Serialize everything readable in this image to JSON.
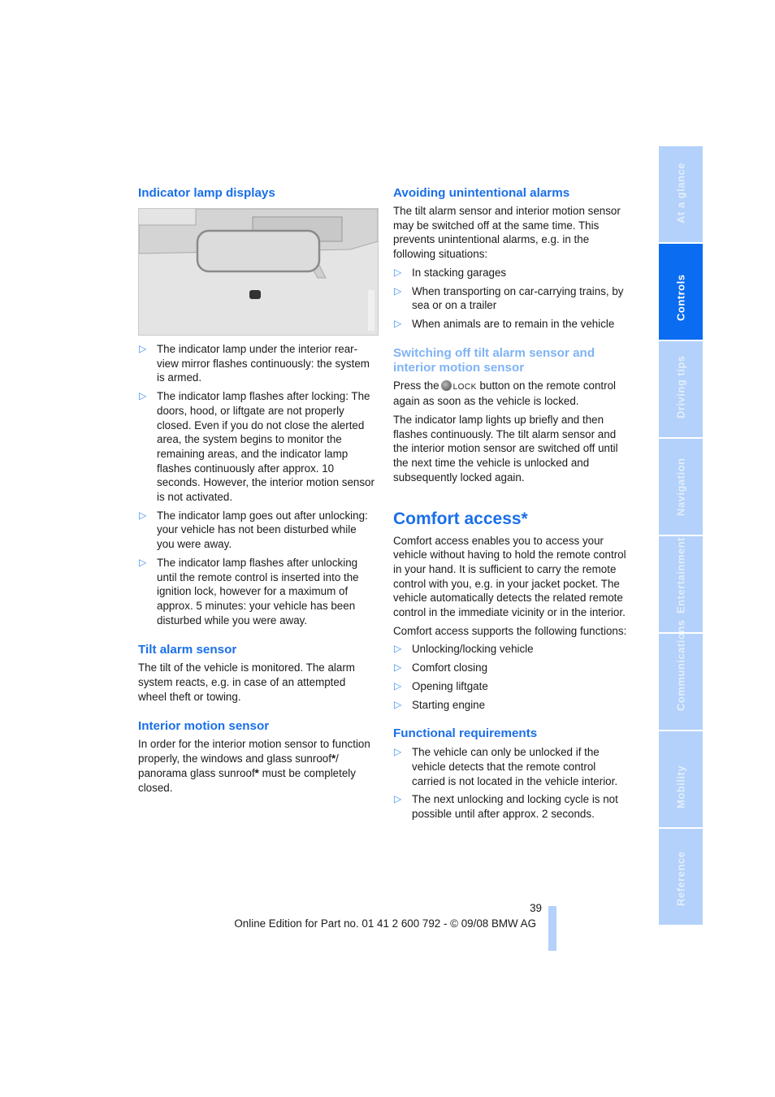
{
  "left_column": {
    "indicator_heading": "Indicator lamp displays",
    "figure_alt": "interior-rearview-mirror-illustration",
    "indicator_items": [
      "The indicator lamp under the interior rear-view mirror flashes continuously: the system is armed.",
      "The indicator lamp flashes after locking: The doors, hood, or liftgate are not properly closed. Even if you do not close the alerted area, the system begins to monitor the remaining areas, and the indicator lamp flashes continuously after approx. 10 seconds. However, the interior motion sensor is not activated.",
      "The indicator lamp goes out after unlocking: your vehicle has not been disturbed while you were away.",
      "The indicator lamp flashes after unlocking until the remote control is inserted into the ignition lock, however for a maximum of approx. 5 minutes: your vehicle has been disturbed while you were away."
    ],
    "tilt_heading": "Tilt alarm sensor",
    "tilt_text": "The tilt of the vehicle is monitored. The alarm system reacts, e.g. in case of an attempted wheel theft or towing.",
    "motion_heading": "Interior motion sensor",
    "motion_text_1": "In order for the interior motion sensor to function properly, the windows and glass sunroof",
    "motion_star_1": "*",
    "motion_text_2": "/ panorama glass sunroof",
    "motion_star_2": "*",
    "motion_text_3": " must be completely closed."
  },
  "right_column": {
    "avoid_heading": "Avoiding unintentional alarms",
    "avoid_text": "The tilt alarm sensor and interior motion sensor may be switched off at the same time. This prevents unintentional alarms, e.g. in the following situations:",
    "avoid_items": [
      "In stacking garages",
      "When transporting on car-carrying trains, by sea or on a trailer",
      "When animals are to remain in the vehicle"
    ],
    "switch_heading": "Switching off tilt alarm sensor and interior motion sensor",
    "switch_text_before": "Press the",
    "lock_label": "LOCK",
    "switch_text_after": "button on the remote control again as soon as the vehicle is locked.",
    "switch_text_2": "The indicator lamp lights up briefly and then flashes continuously. The tilt alarm sensor and the interior motion sensor are switched off until the next time the vehicle is unlocked and subsequently locked again.",
    "comfort_heading": "Comfort access*",
    "comfort_text": "Comfort access enables you to access your vehicle without having to hold the remote control in your hand. It is sufficient to carry the remote control with you, e.g. in your jacket pocket. The vehicle automatically detects the related remote control in the immediate vicinity or in the interior.",
    "comfort_text_2": "Comfort access supports the following functions:",
    "comfort_items": [
      "Unlocking/locking vehicle",
      "Comfort closing",
      "Opening liftgate",
      "Starting engine"
    ],
    "func_heading": "Functional requirements",
    "func_items": [
      "The vehicle can only be unlocked if the vehicle detects that the remote control carried is not located in the vehicle interior.",
      "The next unlocking and locking cycle is not possible until after approx. 2 seconds."
    ]
  },
  "footer": {
    "page_number": "39",
    "edition": "Online Edition for Part no. 01 41 2 600 792 - © 09/08 BMW AG"
  },
  "bullet_glyph": "▷",
  "tabs": [
    {
      "label": "At a glance",
      "active": false
    },
    {
      "label": "Controls",
      "active": true
    },
    {
      "label": "Driving tips",
      "active": false
    },
    {
      "label": "Navigation",
      "active": false
    },
    {
      "label": "Entertainment",
      "active": false
    },
    {
      "label": "Communications",
      "active": false
    },
    {
      "label": "Mobility",
      "active": false
    },
    {
      "label": "Reference",
      "active": false
    }
  ],
  "colors": {
    "heading": "#1a6fe8",
    "subheading_light": "#7fb3f5",
    "tab_active": "#0a6cf0",
    "tab_inactive": "#b3d1fa"
  }
}
